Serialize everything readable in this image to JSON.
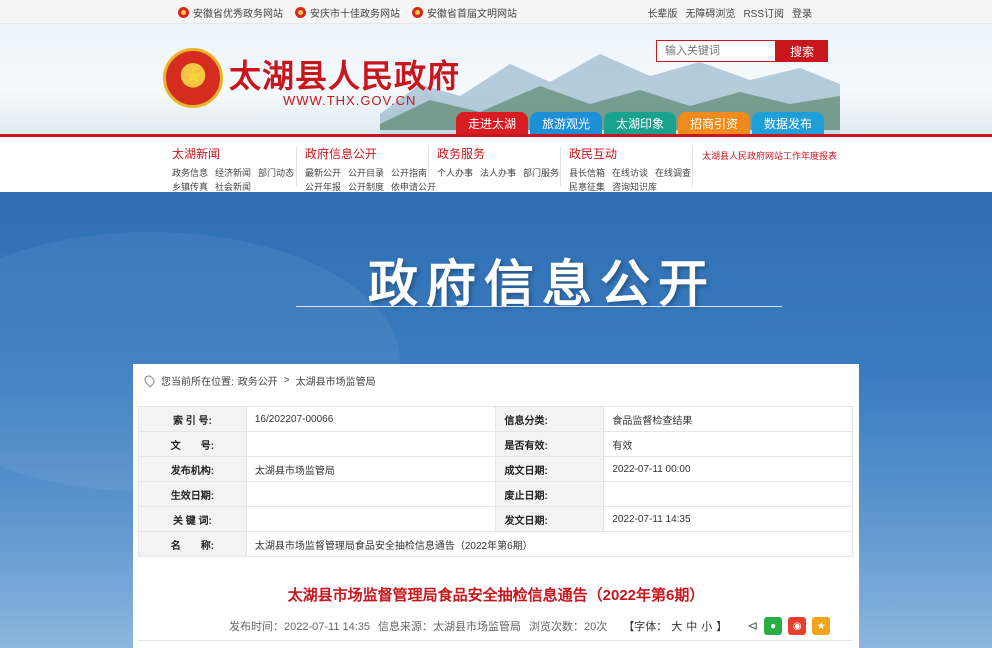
{
  "topbar": {
    "links": [
      "安徽省优秀政务网站",
      "安庆市十佳政务网站",
      "安徽省首届文明网站"
    ],
    "right_links": [
      "长辈版",
      "无障碍浏览",
      "RSS订阅",
      "登录"
    ]
  },
  "header": {
    "title": "太湖县人民政府",
    "url": "WWW.THX.GOV.CN",
    "search_placeholder": "输入关键词",
    "search_button": "搜索",
    "tabs": [
      {
        "label": "走进太湖",
        "color": "#d91c21"
      },
      {
        "label": "旅游观光",
        "color": "#1c8fd6"
      },
      {
        "label": "太湖印象",
        "color": "#1aa28f"
      },
      {
        "label": "招商引资",
        "color": "#ef8b1a"
      },
      {
        "label": "数据发布",
        "color": "#1f9fd8"
      }
    ]
  },
  "submenu": {
    "groups": [
      {
        "title": "太湖新闻",
        "rows": [
          [
            "政务信息",
            "经济新闻",
            "部门动态"
          ],
          [
            "乡镇传真",
            "社会新闻"
          ]
        ]
      },
      {
        "title": "政府信息公开",
        "rows": [
          [
            "最新公开",
            "公开目录",
            "公开指南"
          ],
          [
            "公开年报",
            "公开制度",
            "依申请公开"
          ]
        ]
      },
      {
        "title": "政务服务",
        "rows": [
          [
            "个人办事",
            "法人办事",
            "部门服务"
          ]
        ]
      },
      {
        "title": "政民互动",
        "rows": [
          [
            "县长信箱",
            "在线访谈",
            "在线调查"
          ],
          [
            "民意征集",
            "咨询知识库"
          ]
        ]
      }
    ],
    "report_link": "太湖县人民政府网站工作年度报表"
  },
  "banner": {
    "title": "政府信息公开"
  },
  "breadcrumb": {
    "prefix": "您当前所在位置:",
    "items": [
      "政务公开",
      "太湖县市场监管局"
    ],
    "sep": ">"
  },
  "info": {
    "rows": [
      [
        {
          "label": "索 引 号:",
          "value": "16/202207-00066"
        },
        {
          "label": "信息分类:",
          "value": "食品监督检查结果"
        }
      ],
      [
        {
          "label": "文　　号:",
          "value": ""
        },
        {
          "label": "是否有效:",
          "value": "有效"
        }
      ],
      [
        {
          "label": "发布机构:",
          "value": "太湖县市场监管局"
        },
        {
          "label": "成文日期:",
          "value": "2022-07-11 00:00"
        }
      ],
      [
        {
          "label": "生效日期:",
          "value": ""
        },
        {
          "label": "废止日期:",
          "value": ""
        }
      ],
      [
        {
          "label": "关 键 词:",
          "value": ""
        },
        {
          "label": "发文日期:",
          "value": "2022-07-11 14:35"
        }
      ]
    ],
    "name_label": "名　　称:",
    "name_value": "太湖县市场监督管理局食品安全抽检信息通告（2022年第6期）"
  },
  "article": {
    "title": "太湖县市场监督管理局食品安全抽检信息通告（2022年第6期）",
    "published": "发布时间：2022-07-11 14:35",
    "source": "信息来源：太湖县市场监管局",
    "views": "浏览次数：20次",
    "font_label": "【字体：",
    "font_sizes": [
      "大",
      "中",
      "小"
    ],
    "font_close": "】"
  }
}
